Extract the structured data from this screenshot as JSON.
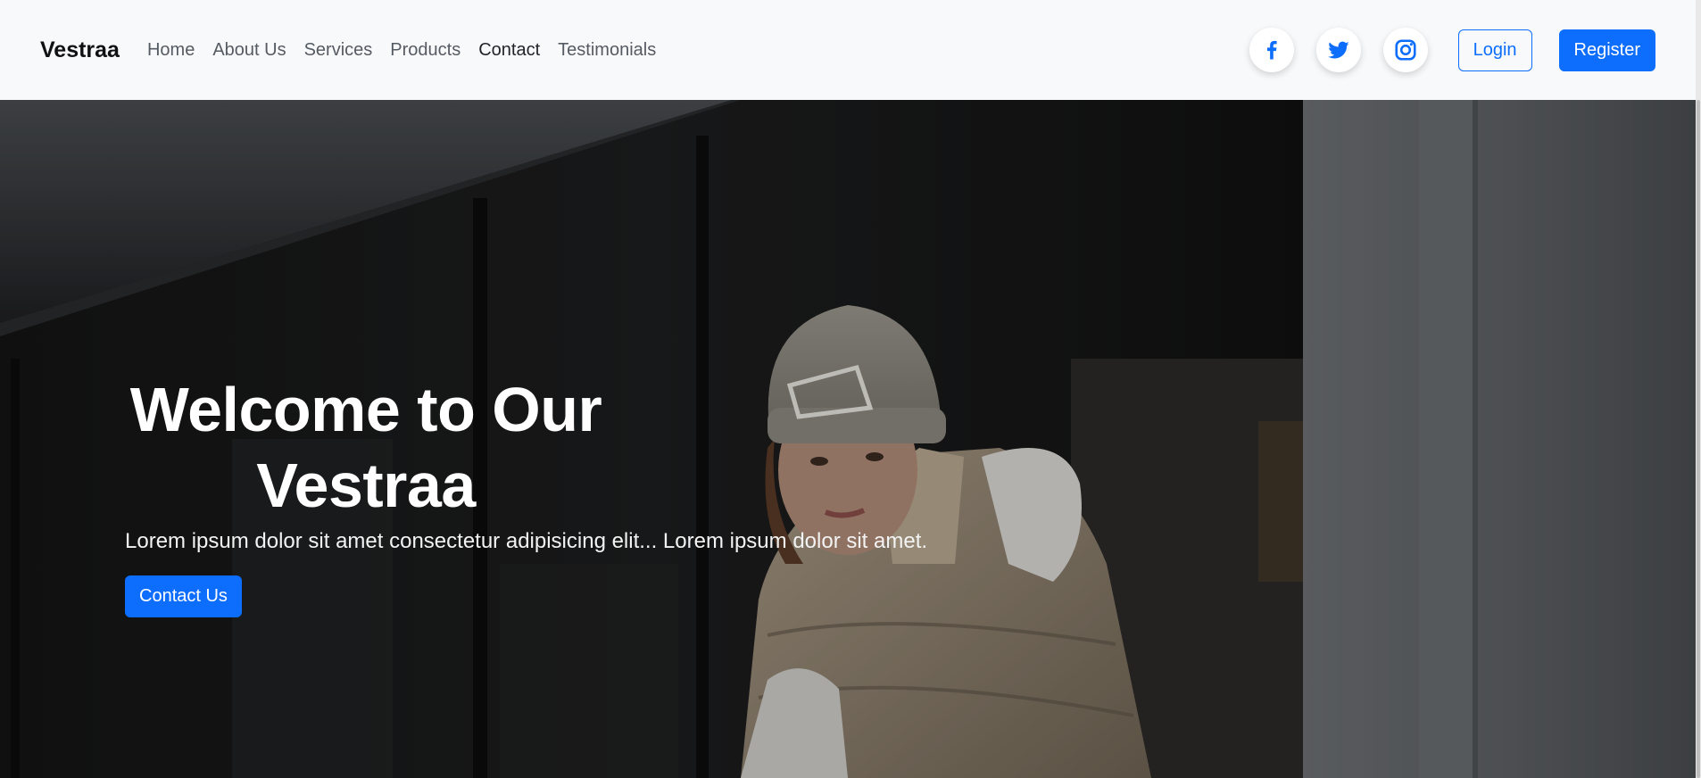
{
  "brand": "Vestraa",
  "nav": {
    "links": [
      {
        "label": "Home",
        "active": false
      },
      {
        "label": "About Us",
        "active": false
      },
      {
        "label": "Services",
        "active": false
      },
      {
        "label": "Products",
        "active": false
      },
      {
        "label": "Contact",
        "active": true
      },
      {
        "label": "Testimonials",
        "active": false
      }
    ],
    "socials": [
      "facebook-icon",
      "twitter-icon",
      "instagram-icon"
    ],
    "login_label": "Login",
    "register_label": "Register"
  },
  "hero": {
    "title_line1": "Welcome to Our",
    "title_line2": "Vestraa",
    "subtitle": "Lorem ipsum dolor sit amet consectetur adipisicing elit... Lorem ipsum dolor sit amet.",
    "cta_label": "Contact Us"
  },
  "colors": {
    "primary": "#0d6efd",
    "navbar_bg": "#f8f9fb",
    "text_dark": "#111111"
  }
}
